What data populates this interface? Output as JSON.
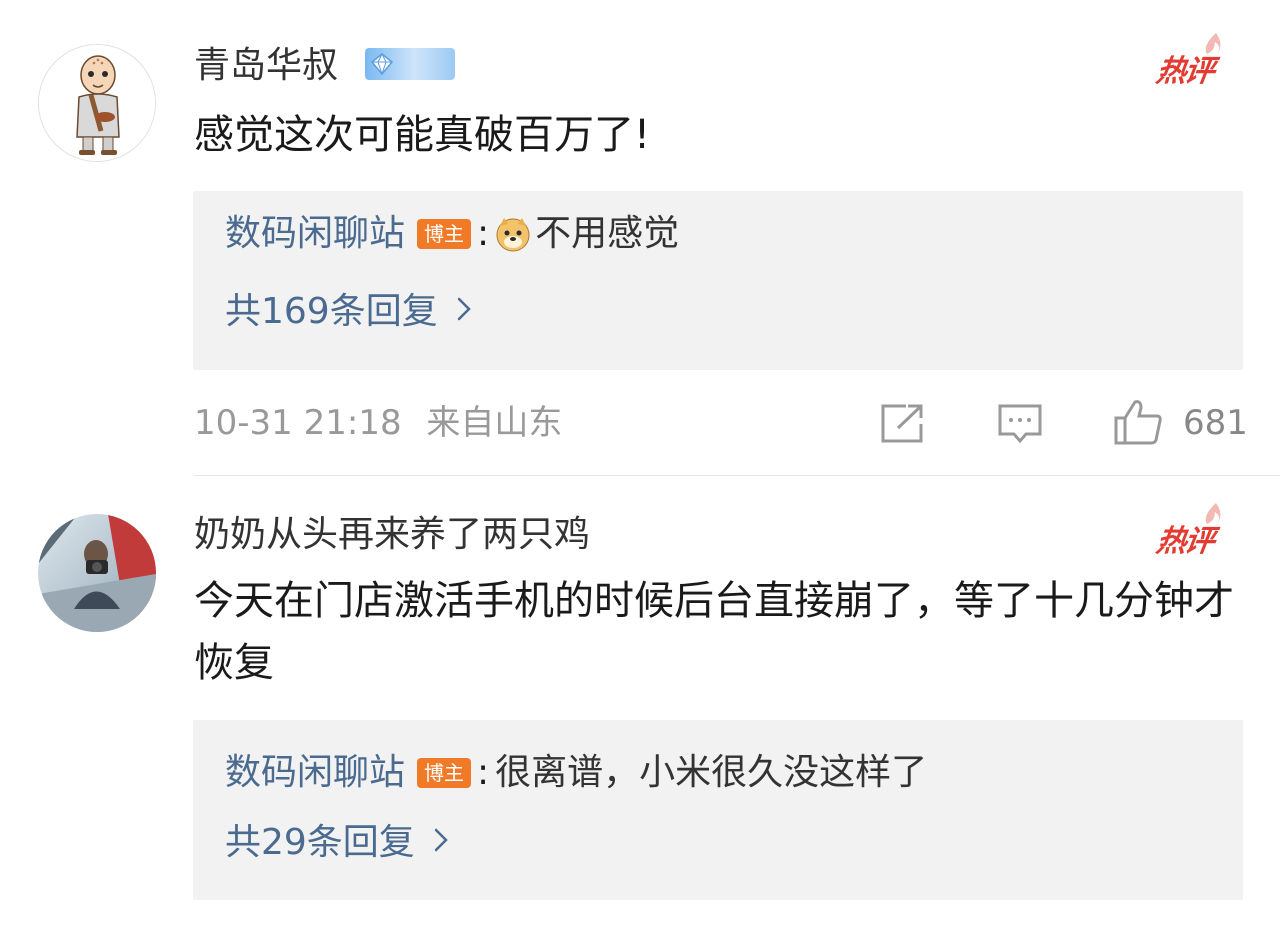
{
  "comments": [
    {
      "username": "青岛华叔",
      "hot_tag": "热评",
      "content": "感觉这次可能真破百万了!",
      "reply": {
        "author": "数码闲聊站",
        "badge": "博主",
        "colon": ":",
        "emoji": "doge-emoji",
        "text": "不用感觉",
        "count_label": "共169条回复"
      },
      "timestamp": "10-31 21:18",
      "location": "来自山东",
      "likes": "681"
    },
    {
      "username": "奶奶从头再来养了两只鸡",
      "hot_tag": "热评",
      "content": "今天在门店激活手机的时候后台直接崩了，等了十几分钟才恢复",
      "reply": {
        "author": "数码闲聊站",
        "badge": "博主",
        "colon": ":",
        "text": "很离谱，小米很久没这样了",
        "count_label": "共29条回复"
      }
    }
  ],
  "icons": {
    "share": "share-icon",
    "comment": "comment-icon",
    "like": "thumbs-up-icon",
    "chevron": "chevron-right-icon",
    "vip": "vip-gem-icon",
    "flame": "flame-icon"
  },
  "colors": {
    "link": "#4a6b8f",
    "hot": "#e33b32",
    "blogger_badge": "#f07a27",
    "reply_bg": "#f2f2f2",
    "meta": "#999999"
  }
}
